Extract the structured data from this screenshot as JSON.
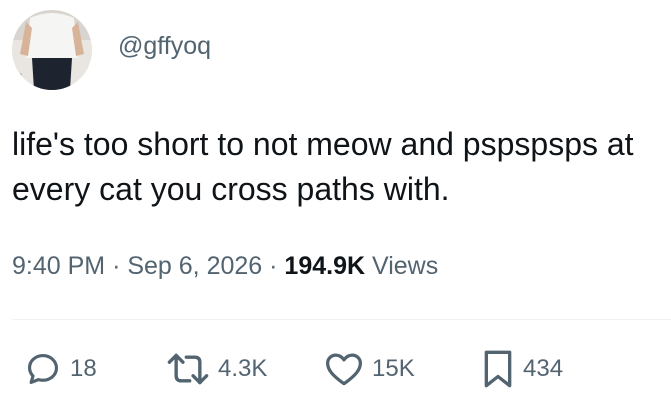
{
  "user": {
    "handle": "@gffyoq"
  },
  "tweet": {
    "text": "life's too short to not meow and pspspsps at every cat you cross paths with.",
    "time": "9:40 PM",
    "date": "Sep 6, 2026",
    "views_count": "194.9K",
    "views_label": "Views",
    "separator": "·"
  },
  "actions": {
    "reply_count": "18",
    "retweet_count": "4.3K",
    "like_count": "15K",
    "bookmark_count": "434"
  },
  "colors": {
    "text_primary": "#0f1419",
    "text_secondary": "#536471",
    "divider": "#eff3f4"
  },
  "icons": {
    "reply": "reply-icon",
    "retweet": "retweet-icon",
    "like": "heart-icon",
    "bookmark": "bookmark-icon"
  }
}
